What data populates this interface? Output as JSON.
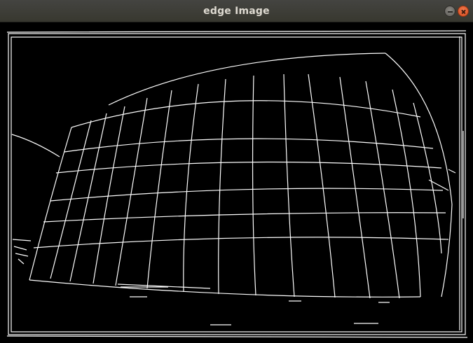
{
  "window": {
    "title": "edge Image",
    "controls": {
      "minimize_icon": "minimize-icon",
      "close_icon": "close-icon"
    }
  },
  "image": {
    "description_colors": {
      "background": "#000000",
      "edges": "#ffffff"
    }
  }
}
